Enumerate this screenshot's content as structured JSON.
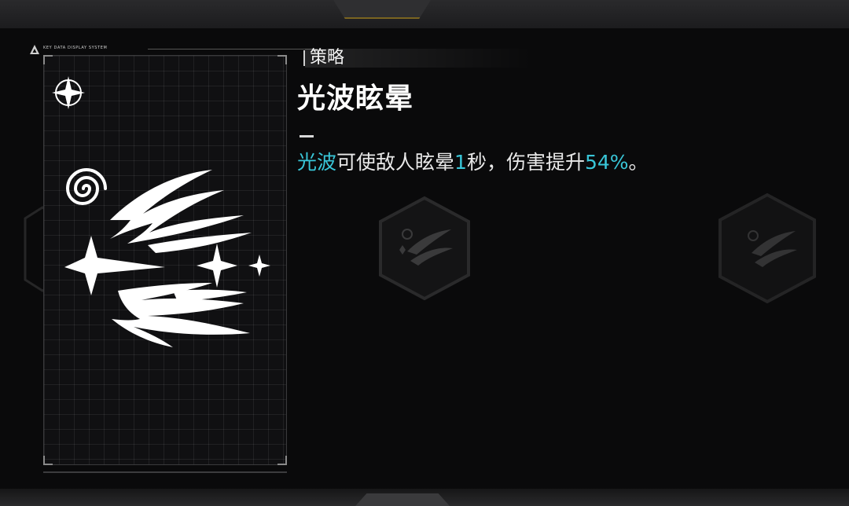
{
  "system_label": "KEY DATA DISPLAY SYSTEM",
  "section": {
    "label": "策略"
  },
  "skill": {
    "title": "光波眩晕",
    "description": {
      "part1": "光波",
      "part2": "可使敌人眩晕",
      "part3": "1",
      "part4": "秒，伤害提升",
      "part5": "54%",
      "part6": "。"
    }
  },
  "icons": {
    "badge": "four-point-star-icon",
    "art": "light-wave-stun-icon",
    "bg_left": "hexagon-skill-icon",
    "bg_center": "hexagon-skill-icon",
    "bg_right": "hexagon-skill-icon"
  },
  "colors": {
    "highlight": "#39c6d8",
    "accent_gold": "#7a6420",
    "text": "#e9e9e9"
  }
}
